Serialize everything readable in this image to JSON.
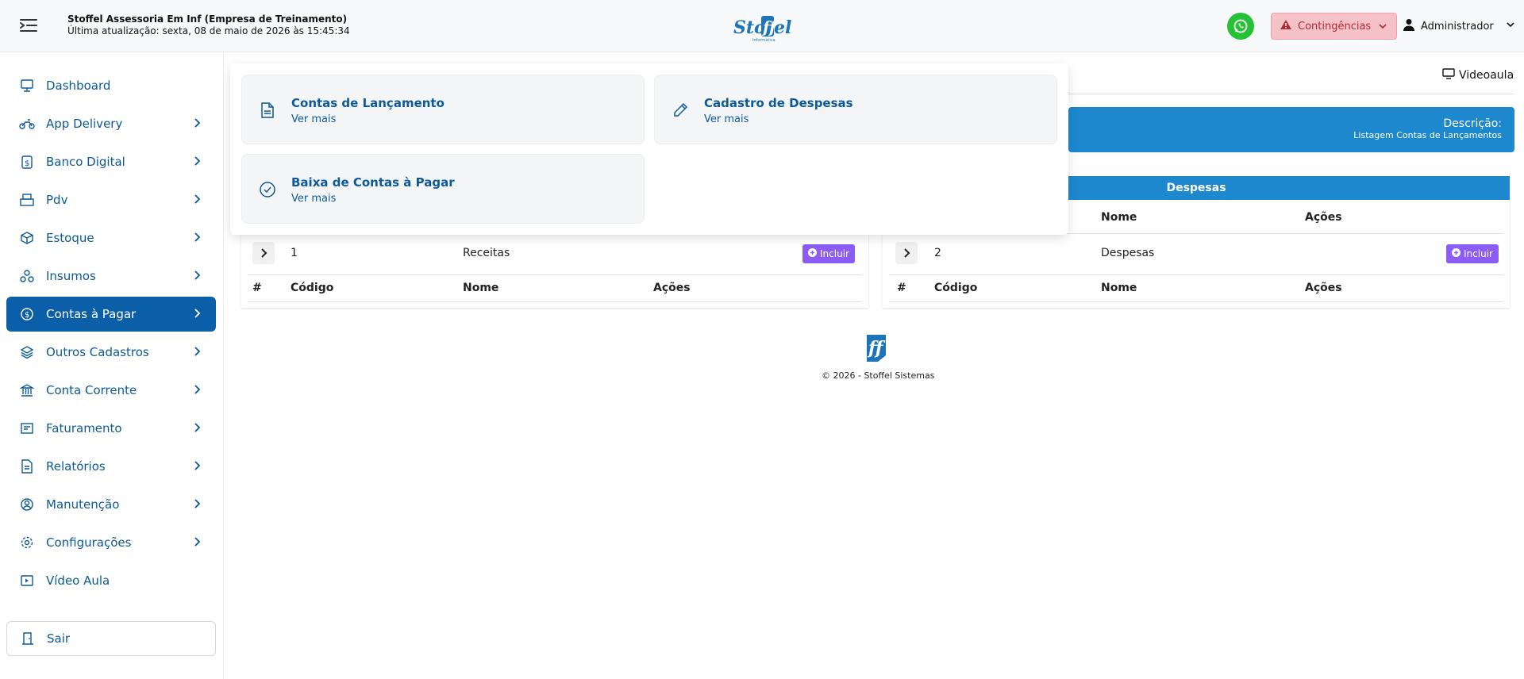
{
  "header": {
    "company_name": "Stoffel Assessoria Em Inf (Empresa de Treinamento)",
    "last_update": "Última atualização: sexta, 08 de maio de 2026 às 15:45:34",
    "logo_text": "Stoffel",
    "logo_subtext": "Informática",
    "contingencias_label": "Contingências",
    "user_label": "Administrador"
  },
  "sidebar": {
    "items": [
      {
        "label": "Dashboard",
        "icon": "dashboard-icon",
        "has_arrow": false
      },
      {
        "label": "App Delivery",
        "icon": "motorcycle-icon",
        "has_arrow": true
      },
      {
        "label": "Banco Digital",
        "icon": "money-icon",
        "has_arrow": true
      },
      {
        "label": "Pdv",
        "icon": "cash-register-icon",
        "has_arrow": true
      },
      {
        "label": "Estoque",
        "icon": "box-icon",
        "has_arrow": true
      },
      {
        "label": "Insumos",
        "icon": "insumos-icon",
        "has_arrow": true
      },
      {
        "label": "Contas à Pagar",
        "icon": "dollar-circle-icon",
        "has_arrow": true,
        "active": true
      },
      {
        "label": "Outros Cadastros",
        "icon": "layers-icon",
        "has_arrow": true
      },
      {
        "label": "Conta Corrente",
        "icon": "bank-icon",
        "has_arrow": true
      },
      {
        "label": "Faturamento",
        "icon": "invoice-icon",
        "has_arrow": true
      },
      {
        "label": "Relatórios",
        "icon": "report-icon",
        "has_arrow": true
      },
      {
        "label": "Manutenção",
        "icon": "user-gear-icon",
        "has_arrow": true
      },
      {
        "label": "Configurações",
        "icon": "gear-icon",
        "has_arrow": true
      },
      {
        "label": "Vídeo Aula",
        "icon": "video-icon",
        "has_arrow": false
      }
    ],
    "logout_label": "Sair"
  },
  "main": {
    "videoaula_label": "Videoaula",
    "description_title": "Descrição:",
    "description_text": "Listagem Contas de Lançamentos",
    "left_table": {
      "row": {
        "code": "1",
        "name": "Receitas",
        "action": "Incluir"
      },
      "headers": [
        "#",
        "Código",
        "Nome",
        "Ações"
      ]
    },
    "right_table": {
      "title": "Despesas",
      "top_headers": [
        "Nome",
        "Ações"
      ],
      "row": {
        "code": "2",
        "name": "Despesas",
        "action": "Incluir"
      },
      "headers": [
        "#",
        "Código",
        "Nome",
        "Ações"
      ]
    },
    "footer": "© 2026 - Stoffel Sistemas"
  },
  "dropdown": {
    "cards": [
      {
        "title": "Contas de Lançamento",
        "more": "Ver mais",
        "icon": "document-icon"
      },
      {
        "title": "Cadastro de Despesas",
        "more": "Ver mais",
        "icon": "pencil-icon"
      },
      {
        "title": "Baixa de Contas à Pagar",
        "more": "Ver mais",
        "icon": "check-circle-icon"
      }
    ]
  },
  "colors": {
    "primary": "#0b5ea8",
    "accent_blue": "#1d88ce",
    "incluir_purple": "#8b5cf6",
    "whatsapp_green": "#25c236",
    "danger_bg": "#f5c2c7"
  }
}
